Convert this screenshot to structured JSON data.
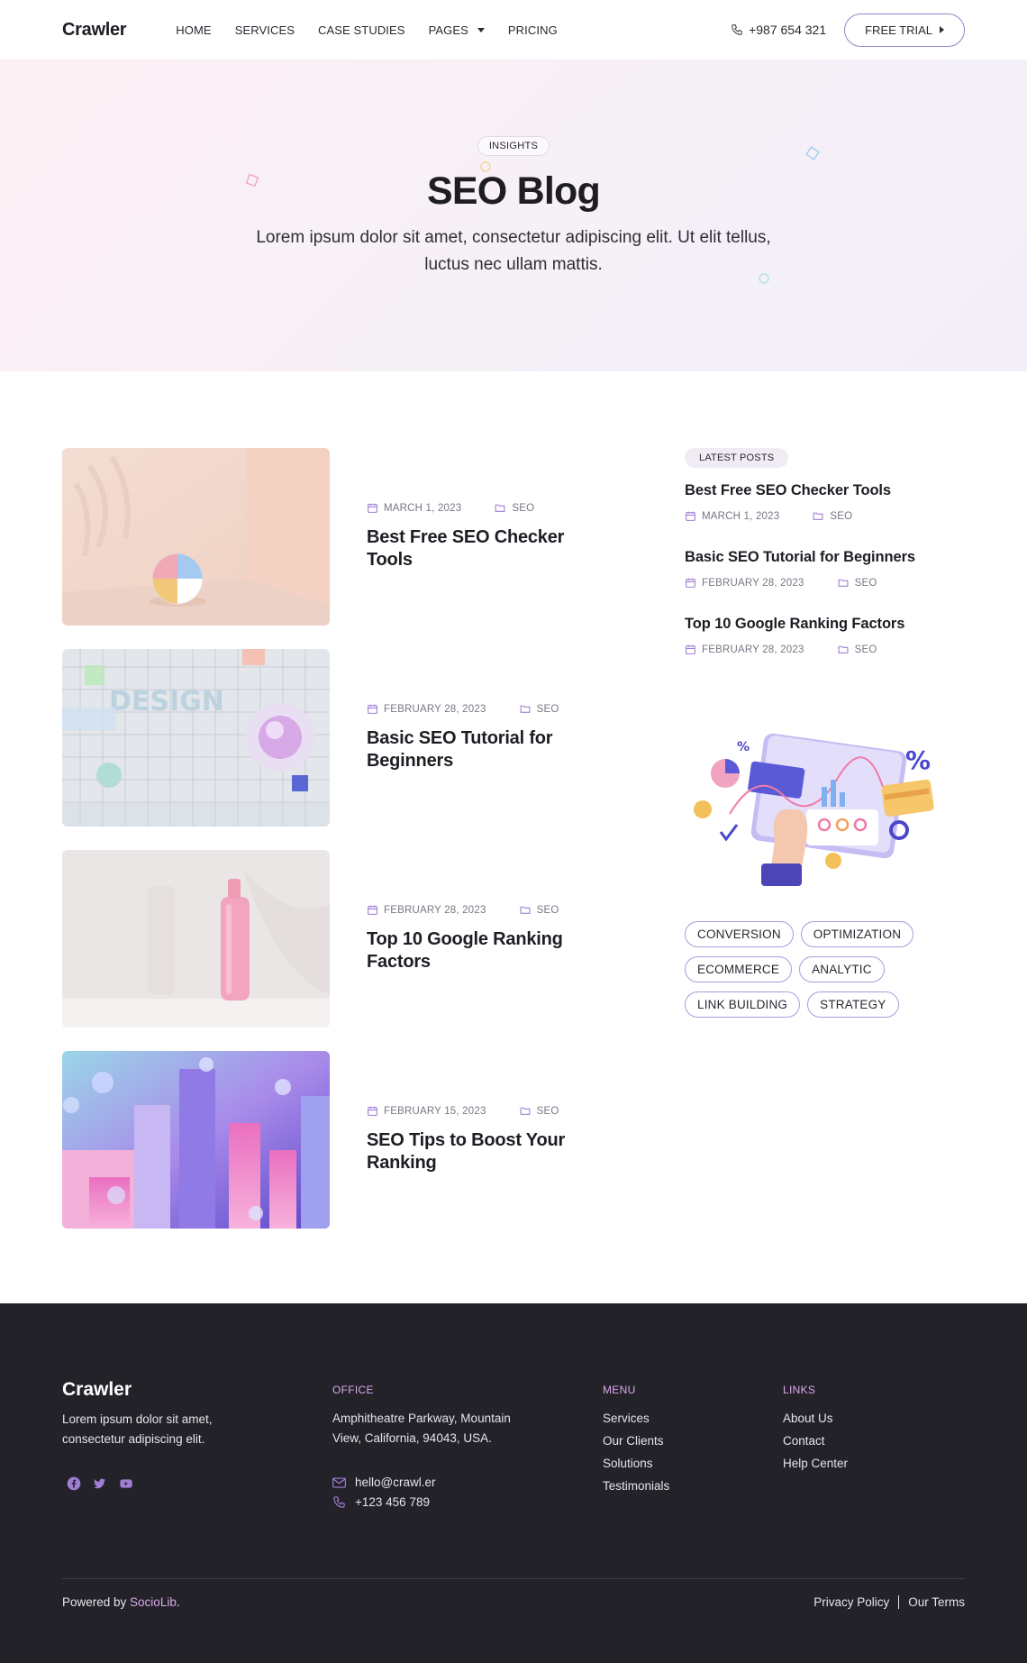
{
  "header": {
    "logo": "Crawler",
    "nav": [
      {
        "label": "HOME"
      },
      {
        "label": "SERVICES"
      },
      {
        "label": "CASE STUDIES"
      },
      {
        "label": "PAGES"
      },
      {
        "label": "PRICING"
      }
    ],
    "phone": "+987 654 321",
    "cta": "FREE TRIAL"
  },
  "hero": {
    "badge": "INSIGHTS",
    "title": "SEO Blog",
    "subtitle": "Lorem ipsum dolor sit amet, consectetur adipiscing elit. Ut elit tellus, luctus nec ullam mattis."
  },
  "posts": [
    {
      "date": "MARCH 1, 2023",
      "category": "SEO",
      "title": "Best Free SEO Checker Tools"
    },
    {
      "date": "FEBRUARY 28, 2023",
      "category": "SEO",
      "title": "Basic SEO Tutorial for Beginners"
    },
    {
      "date": "FEBRUARY 28, 2023",
      "category": "SEO",
      "title": "Top 10 Google Ranking Factors"
    },
    {
      "date": "FEBRUARY 15, 2023",
      "category": "SEO",
      "title": "SEO Tips to Boost Your Ranking"
    }
  ],
  "sidebar": {
    "badge": "LATEST POSTS",
    "latest": [
      {
        "title": "Best Free SEO Checker Tools",
        "date": "MARCH 1, 2023",
        "category": "SEO"
      },
      {
        "title": "Basic SEO Tutorial for Beginners",
        "date": "FEBRUARY 28, 2023",
        "category": "SEO"
      },
      {
        "title": "Top 10 Google Ranking Factors",
        "date": "FEBRUARY 28, 2023",
        "category": "SEO"
      }
    ],
    "tags": [
      "CONVERSION",
      "OPTIMIZATION",
      "ECOMMERCE",
      "ANALYTIC",
      "LINK BUILDING",
      "STRATEGY"
    ]
  },
  "footer": {
    "logo": "Crawler",
    "description": "Lorem ipsum dolor sit amet, consectetur adipiscing elit.",
    "office_heading": "OFFICE",
    "address": "Amphitheatre Parkway, Mountain View, California, 94043, USA.",
    "email": "hello@crawl.er",
    "phone": "+123 456 789",
    "menu_heading": "MENU",
    "menu": [
      "Services",
      "Our Clients",
      "Solutions",
      "Testimonials"
    ],
    "links_heading": "LINKS",
    "links": [
      "About Us",
      "Contact",
      "Help Center"
    ],
    "powered_prefix": "Powered by ",
    "powered_brand": "SocioLib",
    "powered_suffix": ".",
    "privacy": "Privacy Policy",
    "terms": "Our Terms"
  },
  "colors": {
    "accent": "#8c86c9",
    "footer_bg": "#232229",
    "footer_accent": "#d9a9ea"
  },
  "icons": [
    "phone-icon",
    "calendar-icon",
    "folder-icon",
    "mail-icon",
    "facebook-icon",
    "twitter-icon",
    "youtube-icon"
  ]
}
